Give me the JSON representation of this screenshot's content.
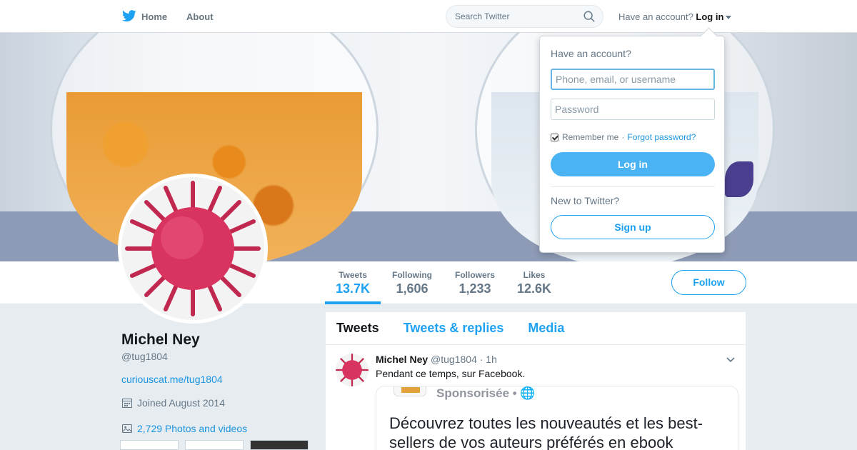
{
  "nav": {
    "home": "Home",
    "about": "About"
  },
  "search": {
    "placeholder": "Search Twitter"
  },
  "account": {
    "prompt": "Have an account?",
    "login": "Log in"
  },
  "dropdown": {
    "title": "Have an account?",
    "username_placeholder": "Phone, email, or username",
    "password_placeholder": "Password",
    "remember": "Remember me",
    "separator": "·",
    "forgot": "Forgot password?",
    "login_button": "Log in",
    "new_prompt": "New to Twitter?",
    "signup_button": "Sign up"
  },
  "stats": [
    {
      "label": "Tweets",
      "value": "13.7K"
    },
    {
      "label": "Following",
      "value": "1,606"
    },
    {
      "label": "Followers",
      "value": "1,233"
    },
    {
      "label": "Likes",
      "value": "12.6K"
    }
  ],
  "follow_button": "Follow",
  "profile": {
    "name": "Michel Ney",
    "handle": "@tug1804",
    "url": "curiouscat.me/tug1804",
    "joined": "Joined August 2014",
    "photos": "2,729 Photos and videos"
  },
  "tabs": [
    "Tweets",
    "Tweets & replies",
    "Media"
  ],
  "tweet": {
    "name": "Michel Ney",
    "handle": "@tug1804",
    "time": "· 1h",
    "text": "Pendant ce temps, sur Facebook.",
    "card_sponsored": "Sponsorisée • 🌐",
    "card_headline": "Découvrez toutes les nouveautés et les best-sellers de vos auteurs préférés en ebook"
  },
  "colors": {
    "accent": "#1da1f2",
    "background": "#e6ecf0"
  }
}
